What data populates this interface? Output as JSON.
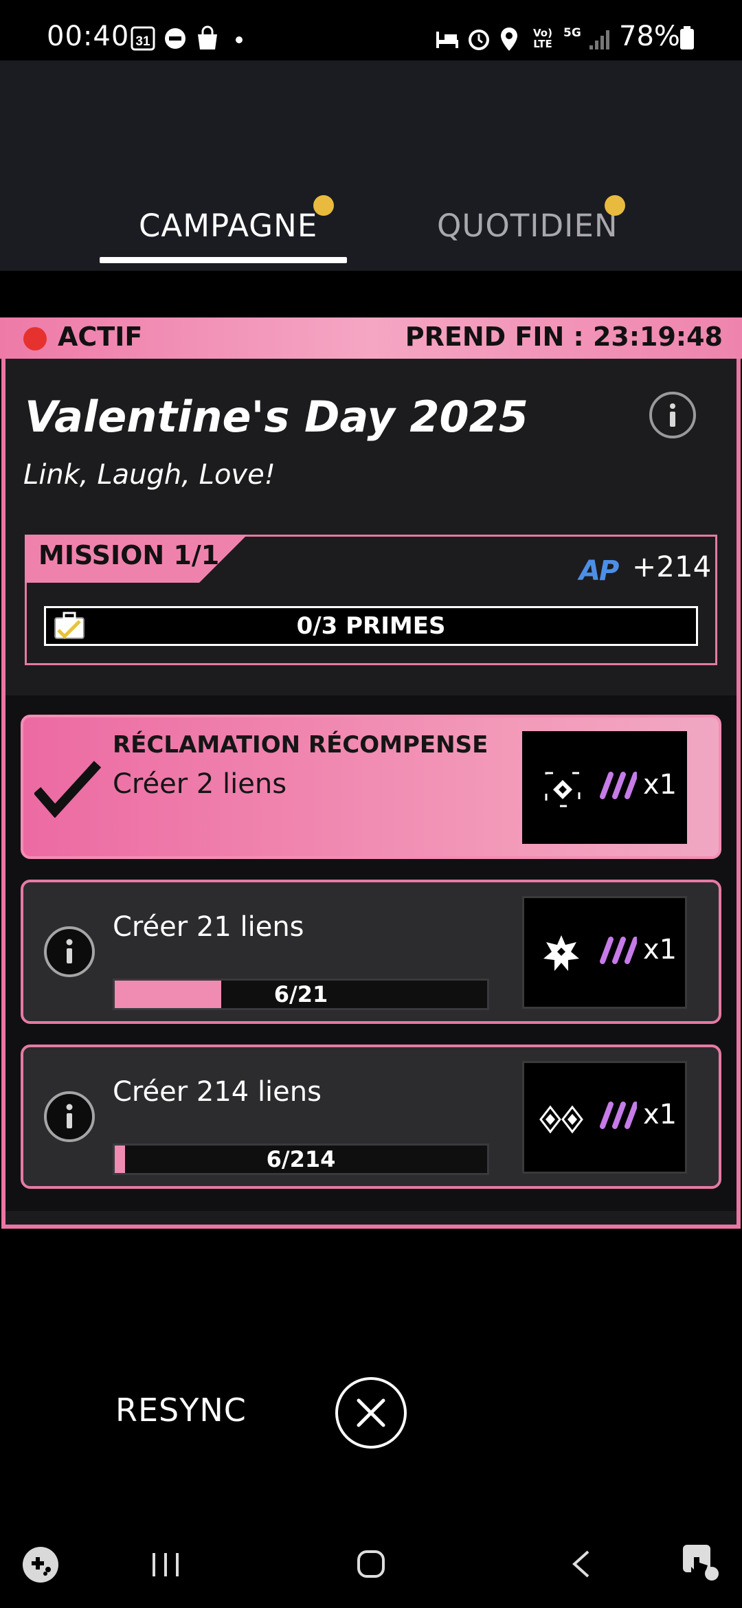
{
  "status_bar": {
    "time": "00:40",
    "calendar_day": "31",
    "network_voice": "Vo) LTE",
    "network_5g": "5G",
    "battery": "78%",
    "icons": [
      "calendar-icon",
      "dnd-icon",
      "shopping-bag-icon",
      "notification-dot",
      "bed-icon",
      "alarm-icon",
      "location-icon",
      "volte-icon",
      "5g-icon",
      "signal-icon",
      "battery-icon"
    ]
  },
  "tabs": [
    {
      "label": "CAMPAGNE",
      "selected": true,
      "has_badge": true
    },
    {
      "label": "QUOTIDIEN",
      "selected": false,
      "has_badge": true
    }
  ],
  "event": {
    "status": "ACTIF",
    "ends": "PREND FIN : 23:19:48",
    "title": "Valentine's Day 2025",
    "subtitle": "Link, Laugh, Love!",
    "mission_label": "MISSION 1/1",
    "ap_logo": "AP",
    "ap_reward": "+214",
    "primes": "0/3 PRIMES"
  },
  "missions": [
    {
      "header": "RÉCLAMATION RÉCOMPENSE",
      "desc": "Créer 2 liens",
      "reward_qty": "x1",
      "state": "claimable"
    },
    {
      "desc": "Créer 21 liens",
      "progress": "6/21",
      "progress_fraction": 0.2857,
      "reward_qty": "x1",
      "state": "in-progress"
    },
    {
      "desc": "Créer 214 liens",
      "progress": "6/214",
      "progress_fraction": 0.028,
      "reward_qty": "x1",
      "state": "in-progress"
    }
  ],
  "footer": {
    "resync_label": "RESYNC"
  },
  "colors": {
    "accent_pink": "#ee7aa8",
    "badge_yellow": "#e8bb3e",
    "active_red": "#e6322e",
    "ap_blue": "#4d8fe6",
    "slash_purple": "#c67be8"
  }
}
